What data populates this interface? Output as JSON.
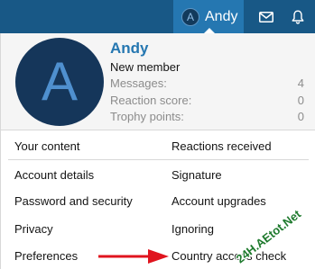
{
  "navbar": {
    "avatar_letter": "A",
    "username": "Andy",
    "inbox_icon": "envelope-icon",
    "alerts_icon": "bell-icon",
    "colors": {
      "bar": "#185886",
      "active_tab": "#2577b1"
    }
  },
  "profile": {
    "avatar_letter": "A",
    "name": "Andy",
    "title": "New member",
    "stats": [
      {
        "label": "Messages:",
        "value": "4"
      },
      {
        "label": "Reaction score:",
        "value": "0"
      },
      {
        "label": "Trophy points:",
        "value": "0"
      }
    ],
    "colors": {
      "avatar_bg": "#15365a",
      "avatar_letter": "#4f90cf",
      "name": "#2577b1"
    }
  },
  "menu": {
    "your_content": "Your content",
    "reactions_received": "Reactions received",
    "account_details": "Account details",
    "signature": "Signature",
    "password_security": "Password and security",
    "account_upgrades": "Account upgrades",
    "privacy": "Privacy",
    "ignoring": "Ignoring",
    "preferences": "Preferences",
    "country_access_check": "Country access check"
  },
  "annotation": {
    "arrow_color": "#e0141e",
    "watermark_text": "24H.AEtot.Net"
  }
}
